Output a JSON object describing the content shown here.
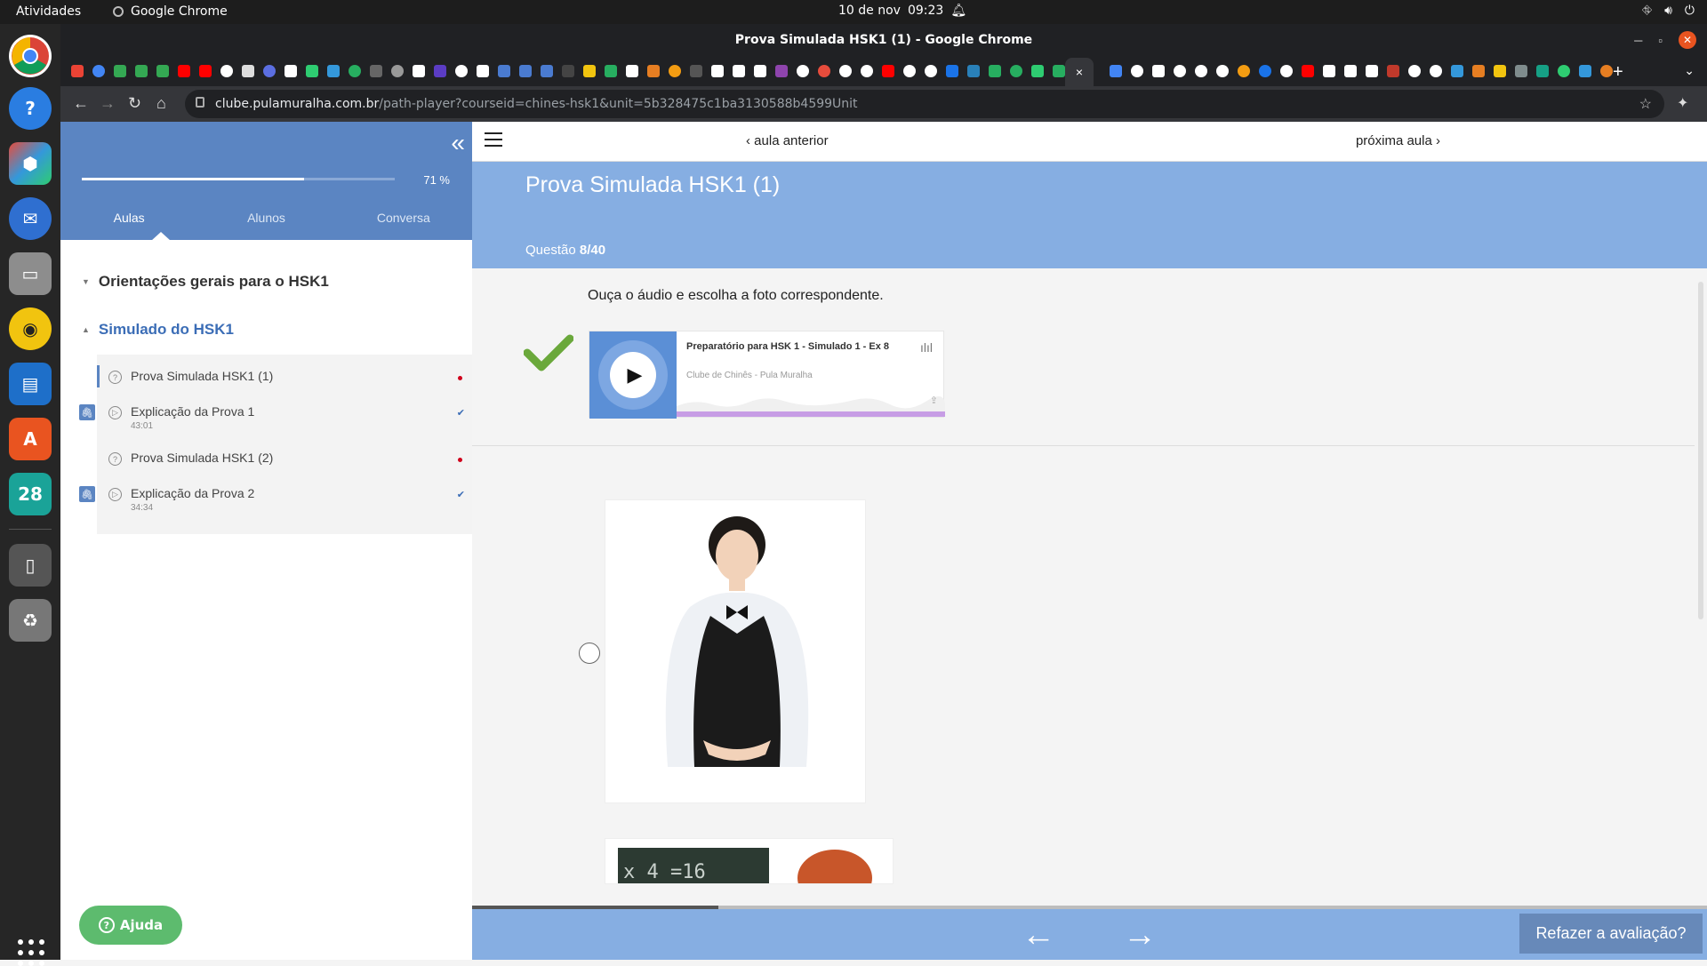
{
  "os": {
    "activities": "Atividades",
    "app_name": "Google Chrome",
    "date": "10 de nov",
    "time": "09:23"
  },
  "browser": {
    "window_title": "Prova Simulada HSK1 (1) - Google Chrome",
    "url_host": "clube.pulamuralha.com.br",
    "url_path": "/path-player?courseid=chines-hsk1&unit=5b328475c1ba3130588b4599Unit",
    "close_tab": "×",
    "new_tab": "+"
  },
  "dock": {
    "calendar_day": "28"
  },
  "sidebar": {
    "progress_label": "71 %",
    "progress_fraction": 0.71,
    "tabs": [
      "Aulas",
      "Alunos",
      "Conversa"
    ],
    "sections": [
      {
        "label": "Orientações gerais para o HSK1"
      },
      {
        "label": "Simulado do HSK1"
      }
    ],
    "lessons": [
      {
        "title": "Prova Simulada HSK1 (1)",
        "duration": ""
      },
      {
        "title": "Explicação da Prova 1",
        "duration": "43:01"
      },
      {
        "title": "Prova Simulada HSK1 (2)",
        "duration": ""
      },
      {
        "title": "Explicação da Prova 2",
        "duration": "34:34"
      }
    ],
    "help_label": "Ajuda"
  },
  "lesson_nav": {
    "prev": "aula anterior",
    "next": "próxima aula"
  },
  "banner": {
    "title": "Prova Simulada HSK1 (1)",
    "question_label": "Questão",
    "question_number": "8/40"
  },
  "question": {
    "prompt": "Ouça o áudio e escolha a foto correspondente."
  },
  "player": {
    "track_title": "Preparatório para HSK 1 - Simulado 1 - Ex 8",
    "author": "Clube de Chinês - Pula Muralha"
  },
  "footer": {
    "redo_label": "Refazer a avaliação?"
  },
  "colors": {
    "accent": "#5b85c2",
    "banner": "#86aee2",
    "success": "#6aa83b",
    "help": "#5dbb6e"
  }
}
